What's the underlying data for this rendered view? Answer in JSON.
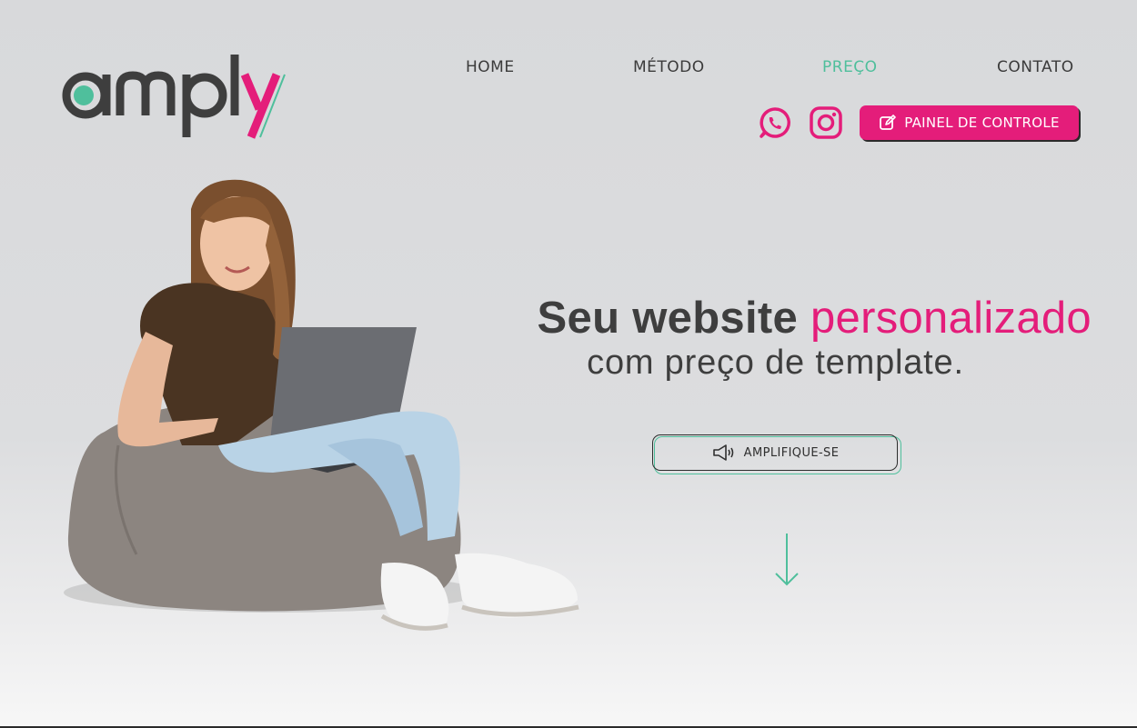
{
  "brand": {
    "logo_text": "amply",
    "colors": {
      "dark": "#3e3e3e",
      "pink": "#e41d7a",
      "teal": "#4fbf9c"
    }
  },
  "nav": {
    "items": [
      {
        "label": "HOME",
        "active": false
      },
      {
        "label": "MÉTODO",
        "active": false
      },
      {
        "label": "PREÇO",
        "active": true
      },
      {
        "label": "CONTATO",
        "active": false
      }
    ]
  },
  "header_actions": {
    "whatsapp_icon": "whatsapp-icon",
    "instagram_icon": "instagram-icon",
    "panel_button": {
      "icon": "edit-icon",
      "label": "PAINEL DE CONTROLE"
    }
  },
  "hero": {
    "title_part1": "Seu website",
    "title_accent": "personalizado",
    "subtitle": "com preço de template.",
    "cta": {
      "icon": "megaphone-icon",
      "label": "AMPLIFIQUE-SE"
    },
    "scroll_icon": "arrow-down-icon",
    "image": "woman-with-laptop-on-beanbag"
  }
}
